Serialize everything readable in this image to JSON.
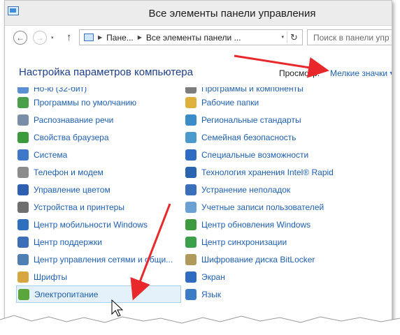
{
  "window": {
    "title": "Все элементы панели управления"
  },
  "nav": {
    "back_icon": "←",
    "forward_icon": "→",
    "recent_icon": "▾",
    "up_icon": "↑"
  },
  "address": {
    "crumbs": [
      "Пане...",
      "Все элементы панели ..."
    ],
    "separator": "▶",
    "dropdown_icon": "▾",
    "refresh_icon": "↻"
  },
  "search": {
    "placeholder": "Поиск в панели упр"
  },
  "header": {
    "title": "Настройка параметров компьютера",
    "view_label": "Просмотр:",
    "view_value": "Мелкие значки ▾"
  },
  "left_items": [
    {
      "label": "Но-ю (32-бит)",
      "icon_color": "#5a8fd6",
      "cut": true
    },
    {
      "label": "Программы по умолчанию",
      "icon_color": "#4aa04a"
    },
    {
      "label": "Распознавание речи",
      "icon_color": "#7a8ea8"
    },
    {
      "label": "Свойства браузера",
      "icon_color": "#3b9a3b"
    },
    {
      "label": "Система",
      "icon_color": "#3f78c9"
    },
    {
      "label": "Телефон и модем",
      "icon_color": "#8c8c8c"
    },
    {
      "label": "Управление цветом",
      "icon_color": "#2f5fb0"
    },
    {
      "label": "Устройства и принтеры",
      "icon_color": "#6f6f6f"
    },
    {
      "label": "Центр мобильности Windows",
      "icon_color": "#2e6fbe"
    },
    {
      "label": "Центр поддержки",
      "icon_color": "#3d6fb8"
    },
    {
      "label": "Центр управления сетями и общи...",
      "icon_color": "#4d7fb4"
    },
    {
      "label": "Шрифты",
      "icon_color": "#d8a640"
    },
    {
      "label": "Электропитание",
      "icon_color": "#5aa53c",
      "selected": true
    }
  ],
  "right_items": [
    {
      "label": "Программы и компоненты",
      "icon_color": "#7d7d7d",
      "cut": true
    },
    {
      "label": "Рабочие папки",
      "icon_color": "#e0b03c"
    },
    {
      "label": "Региональные стандарты",
      "icon_color": "#3b8bc8"
    },
    {
      "label": "Семейная безопасность",
      "icon_color": "#4a9acc"
    },
    {
      "label": "Специальные возможности",
      "icon_color": "#2d6cc0"
    },
    {
      "label": "Технология хранения Intel® Rapid",
      "icon_color": "#2a63b0"
    },
    {
      "label": "Устранение неполадок",
      "icon_color": "#3a6fb9"
    },
    {
      "label": "Учетные записи пользователей",
      "icon_color": "#6aa0d4"
    },
    {
      "label": "Центр обновления Windows",
      "icon_color": "#3e9a3e"
    },
    {
      "label": "Центр синхронизации",
      "icon_color": "#3aa14a"
    },
    {
      "label": "Шифрование диска BitLocker",
      "icon_color": "#b09a5a"
    },
    {
      "label": "Экран",
      "icon_color": "#2f6bbf"
    },
    {
      "label": "Язык",
      "icon_color": "#3c7cc4"
    }
  ],
  "colors": {
    "link": "#1f5fb0",
    "title": "#1e3f8c",
    "selection": "#e4f1fb",
    "arrow": "#e8282a"
  }
}
